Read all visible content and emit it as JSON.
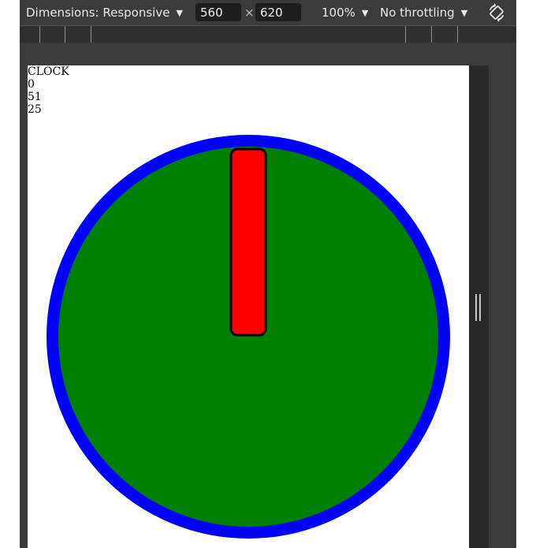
{
  "toolbar": {
    "dimensions_label": "Dimensions: Responsive",
    "width_value": "560",
    "times_symbol": "×",
    "height_value": "620",
    "zoom_label": "100%",
    "throttling_label": "No throttling",
    "caret": "▼",
    "rotate_icon": "rotate-device-icon"
  },
  "page": {
    "title": "CLOCK",
    "lines": [
      "0",
      "51",
      "25"
    ]
  },
  "clock": {
    "outer_ring_color": "#0000ff",
    "face_color": "#008000",
    "hand_color": "#ff0000",
    "hand_outline_color": "#000000"
  }
}
